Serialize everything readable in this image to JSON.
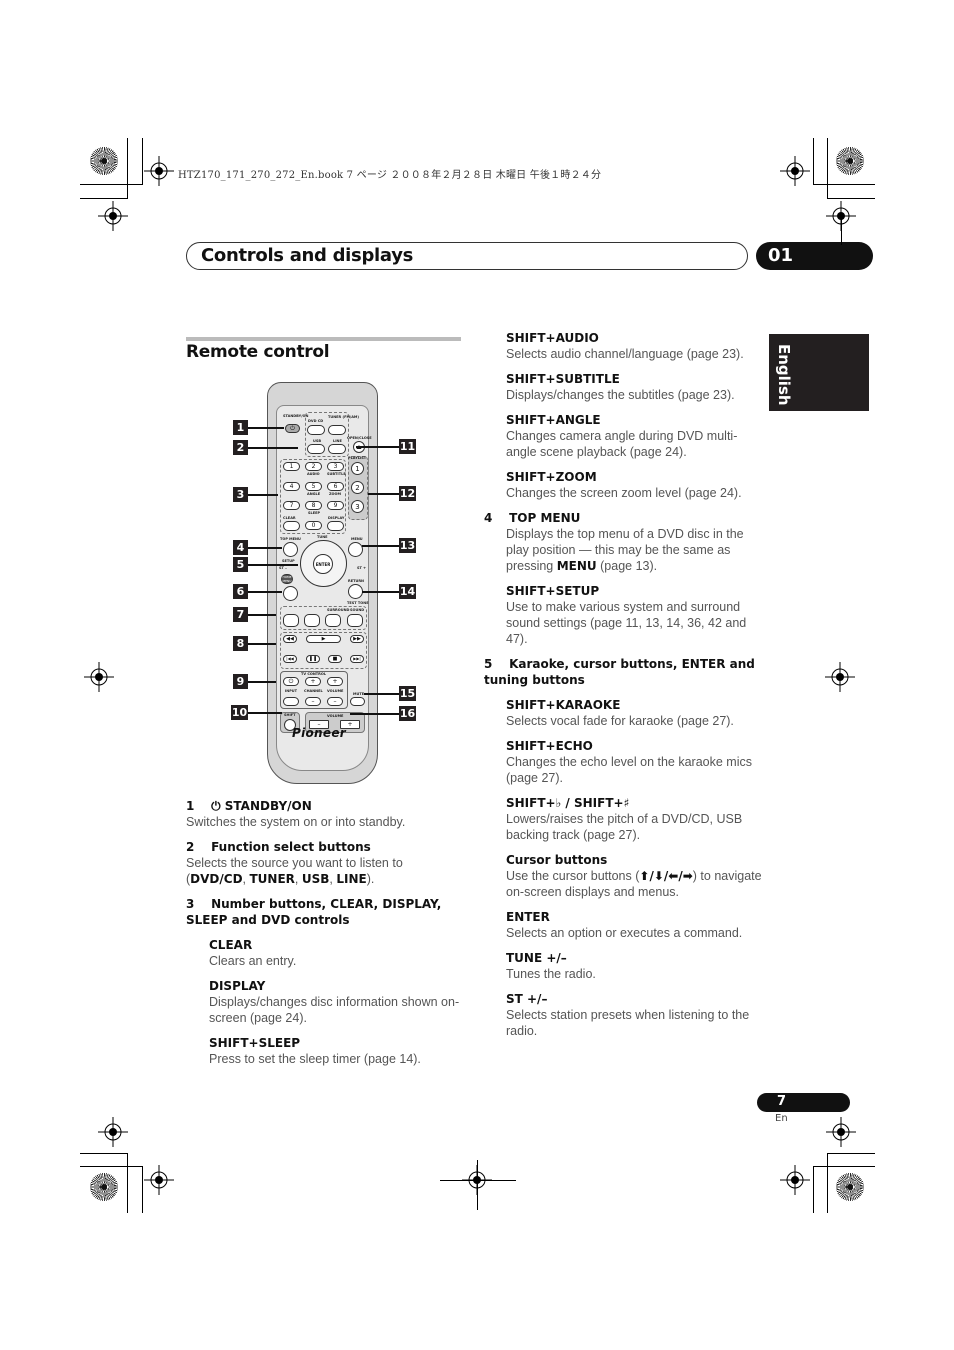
{
  "print_job_line": "HTZ170_171_270_272_En.book  7 ページ  ２００８年２月２８日  木曜日  午後１時２４分",
  "header": {
    "title": "Controls and displays",
    "chapter_number": "01"
  },
  "language_tab": "English",
  "section": {
    "title": "Remote control"
  },
  "remote": {
    "brand": "Pioneer",
    "labels": {
      "standby_on": "STANDBY/ON",
      "dvd_cd": "DVD CD",
      "tuner": "TUNER (FM/AM)",
      "usb": "USB",
      "line": "LINE",
      "open_close": "OPEN/CLOSE",
      "playlist": "PLAYLIST",
      "audio": "AUDIO",
      "subtitle": "SUBTITLE",
      "angle": "ANGLE",
      "zoom": "ZOOM",
      "sleep": "SLEEP",
      "clear": "CLEAR",
      "display": "DISPLAY",
      "top_menu": "TOP MENU",
      "menu": "MENU",
      "setup": "SETUP",
      "tune": "TUNE",
      "enter": "ENTER",
      "st_minus": "ST –",
      "st_plus": "ST +",
      "home_menu": "HOME MENU",
      "return": "RETURN",
      "test_tone": "TEST TONE",
      "surround": "SURROUND",
      "sound": "SOUND",
      "tv_control": "TV CONTROL",
      "input": "INPUT",
      "channel": "CHANNEL",
      "volume": "VOLUME",
      "mute": "MUTE",
      "shift": "SHIFT"
    },
    "number_keys": [
      "1",
      "2",
      "3",
      "4",
      "5",
      "6",
      "7",
      "8",
      "9",
      "0"
    ],
    "playlist_keys": [
      "1",
      "2",
      "3"
    ],
    "callouts": [
      "1",
      "2",
      "3",
      "4",
      "5",
      "6",
      "7",
      "8",
      "9",
      "10",
      "11",
      "12",
      "13",
      "14",
      "15",
      "16"
    ]
  },
  "left_column": [
    {
      "heading_num": "1",
      "heading": "STANDBY/ON",
      "icon": "power-icon",
      "body": "Switches the system on or into standby."
    },
    {
      "heading_num": "2",
      "heading": "Function select buttons",
      "body_pre": "Selects the source you want to listen to (",
      "body_bold": [
        "DVD/CD",
        "TUNER",
        "USB",
        "LINE"
      ],
      "body_post": ")."
    },
    {
      "heading_num": "3",
      "heading": "Number buttons, CLEAR, DISPLAY, SLEEP and DVD controls"
    },
    {
      "sub_heading": "CLEAR",
      "body": "Clears an entry."
    },
    {
      "sub_heading": "DISPLAY",
      "body": "Displays/changes disc information shown on-screen (page 24)."
    },
    {
      "sub_heading": "SHIFT+SLEEP",
      "body": "Press to set the sleep timer (page 14)."
    }
  ],
  "right_column": [
    {
      "sub_heading": "SHIFT+AUDIO",
      "body": "Selects audio channel/language (page 23)."
    },
    {
      "sub_heading": "SHIFT+SUBTITLE",
      "body": "Displays/changes the subtitles (page 23)."
    },
    {
      "sub_heading": "SHIFT+ANGLE",
      "body": "Changes camera angle during DVD multi-angle scene playback (page 24)."
    },
    {
      "sub_heading": "SHIFT+ZOOM",
      "body": "Changes the screen zoom level (page 24)."
    },
    {
      "heading_num": "4",
      "heading": "TOP MENU",
      "body_pre": "Displays the top menu of a DVD disc in the play position — this may be the same as pressing ",
      "body_bold": "MENU",
      "body_post": " (page 13)."
    },
    {
      "sub_heading": "SHIFT+SETUP",
      "body": "Use to make various system and surround sound settings (page 11, 13, 14, 36, 42 and 47)."
    },
    {
      "heading_num": "5",
      "heading": "Karaoke, cursor buttons, ENTER and tuning buttons"
    },
    {
      "sub_heading": "SHIFT+KARAOKE",
      "body": "Selects vocal fade for karaoke (page 27)."
    },
    {
      "sub_heading": "SHIFT+ECHO",
      "body": "Changes the echo level on the karaoke mics (page 27)."
    },
    {
      "sub_heading": "SHIFT+♭ / SHIFT+♯",
      "body": "Lowers/raises the pitch of a DVD/CD, USB backing track (page 27)."
    },
    {
      "sub_heading": "Cursor buttons",
      "body_pre": "Use the cursor buttons (",
      "arrows": "⬆/⬇/⬅/➡",
      "body_post": ") to navigate on-screen displays and menus."
    },
    {
      "sub_heading": "ENTER",
      "body": "Selects an option or executes a command."
    },
    {
      "sub_heading": "TUNE +/–",
      "body": "Tunes the radio."
    },
    {
      "sub_heading": "ST +/–",
      "body": "Selects station presets when listening to the radio."
    }
  ],
  "footer": {
    "page_number": "7",
    "page_lang": "En"
  }
}
